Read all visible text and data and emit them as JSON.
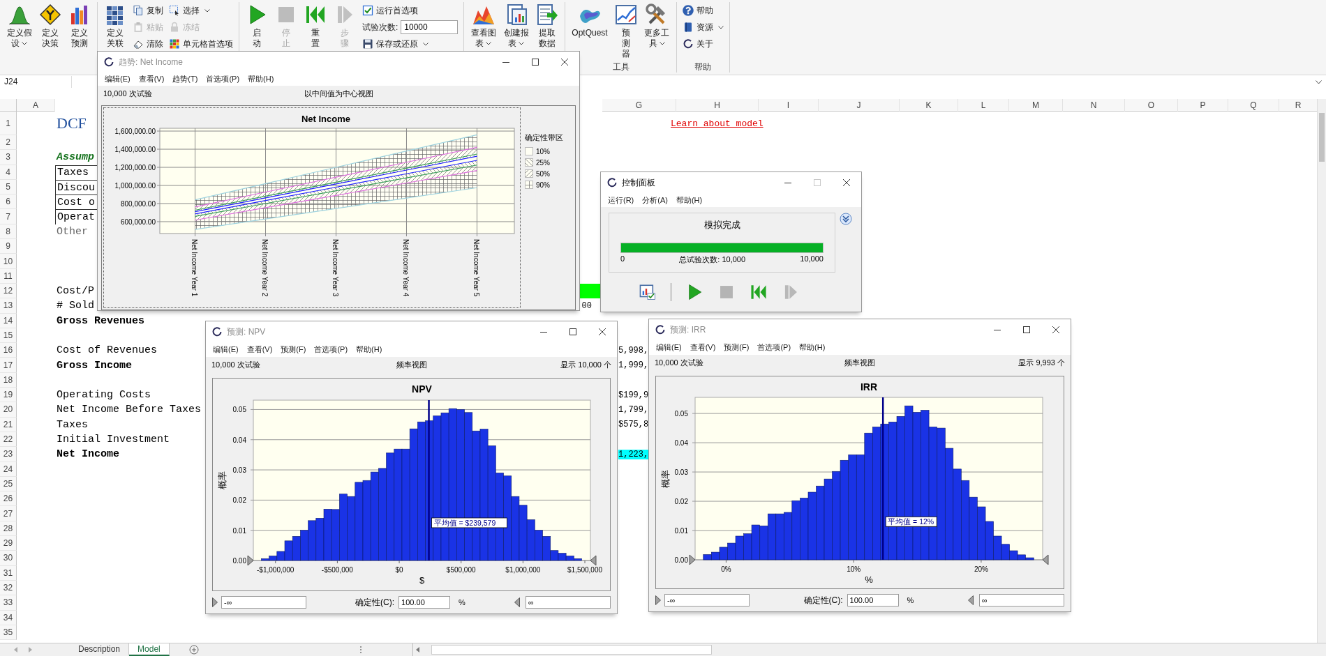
{
  "ribbon": {
    "groups": [
      {
        "items": [
          {
            "kind": "large",
            "label": "定义假设",
            "dropdown": true,
            "disabled": false
          },
          {
            "kind": "large",
            "label": "定义决策",
            "dropdown": false,
            "disabled": false
          },
          {
            "kind": "large",
            "label": "定义预测",
            "dropdown": false,
            "disabled": false
          }
        ]
      },
      {
        "items": [
          {
            "kind": "large",
            "label": "定义关联",
            "dropdown": false,
            "disabled": false
          },
          {
            "kind": "stack",
            "entries": [
              {
                "kind": "button",
                "label": "复制",
                "dropdown": false,
                "disabled": false
              },
              {
                "kind": "button",
                "label": "粘贴",
                "dropdown": false,
                "disabled": true
              },
              {
                "kind": "button",
                "label": "清除",
                "dropdown": false,
                "disabled": false
              }
            ]
          },
          {
            "kind": "stack",
            "entries": [
              {
                "kind": "button",
                "label": "选择",
                "dropdown": true,
                "disabled": false
              },
              {
                "kind": "button",
                "label": "冻结",
                "dropdown": false,
                "disabled": true
              },
              {
                "kind": "button",
                "label": "单元格首选项",
                "dropdown": false,
                "disabled": false
              }
            ]
          }
        ]
      },
      {
        "items": [
          {
            "kind": "large",
            "label": "启动",
            "dropdown": false,
            "disabled": false
          },
          {
            "kind": "large",
            "label": "停止",
            "dropdown": false,
            "disabled": true
          },
          {
            "kind": "large",
            "label": "重置",
            "dropdown": false,
            "disabled": false
          },
          {
            "kind": "large",
            "label": "步骤",
            "dropdown": false,
            "disabled": true
          },
          {
            "kind": "stack",
            "entries": [
              {
                "kind": "button",
                "label": "运行首选项",
                "dropdown": false,
                "disabled": false
              },
              {
                "kind": "field",
                "label": "试验次数:",
                "value": "10000"
              },
              {
                "kind": "button",
                "label": "保存或还原",
                "dropdown": true,
                "disabled": false
              }
            ]
          }
        ]
      },
      {
        "items": [
          {
            "kind": "large",
            "label": "查看图表",
            "dropdown": true,
            "disabled": false
          },
          {
            "kind": "large",
            "label": "创建报表",
            "dropdown": true,
            "disabled": false
          },
          {
            "kind": "large",
            "label": "提取数据",
            "dropdown": false,
            "disabled": false
          }
        ]
      },
      {
        "label": "工具",
        "items": [
          {
            "kind": "large",
            "label": "OptQuest",
            "dropdown": false,
            "disabled": false
          },
          {
            "kind": "large",
            "label": "预测器",
            "dropdown": false,
            "disabled": false
          },
          {
            "kind": "large",
            "label": "更多工具",
            "dropdown": true,
            "disabled": false
          }
        ]
      },
      {
        "label": "帮助",
        "items": [
          {
            "kind": "stack",
            "entries": [
              {
                "kind": "button",
                "label": "帮助",
                "dropdown": false,
                "disabled": false
              },
              {
                "kind": "button",
                "label": "资源",
                "dropdown": true,
                "disabled": false
              },
              {
                "kind": "button",
                "label": "关于",
                "dropdown": false,
                "disabled": false
              }
            ]
          }
        ]
      }
    ]
  },
  "name_box": "J24",
  "sheet": {
    "columns": [
      "A",
      "G",
      "H",
      "I",
      "J",
      "K",
      "L",
      "M",
      "N",
      "O",
      "P",
      "Q",
      "R"
    ],
    "rows": [
      {
        "number": "1",
        "kind": "title",
        "col_b": {
          "text": "DCF"
        },
        "col_h": {
          "text": "Learn about model",
          "kind": "link"
        }
      },
      {
        "number": "2"
      },
      {
        "number": "3",
        "kind": "section",
        "col_b": {
          "text": "Assump"
        }
      },
      {
        "number": "4",
        "kind": "boxed",
        "col_b": {
          "text": "Taxes"
        }
      },
      {
        "number": "5",
        "kind": "boxed",
        "col_b": {
          "text": "Discou"
        }
      },
      {
        "number": "6",
        "kind": "boxed",
        "col_b": {
          "text": "Cost o"
        }
      },
      {
        "number": "7",
        "kind": "boxed",
        "col_b": {
          "text": "Operat"
        }
      },
      {
        "number": "8",
        "kind": "muted",
        "col_b": {
          "text": "Other"
        }
      },
      {
        "number": "9"
      },
      {
        "number": "10"
      },
      {
        "number": "11"
      },
      {
        "number": "12",
        "kind": "plain",
        "col_b": {
          "text": "Cost/P"
        },
        "col_f": {
          "color": "#00ff00"
        }
      },
      {
        "number": "13",
        "kind": "plain",
        "col_b": {
          "text": "# Sold"
        },
        "col_f": {
          "text": "00"
        }
      },
      {
        "number": "14",
        "kind": "bold",
        "col_b": {
          "text": "Gross Revenues"
        }
      },
      {
        "number": "15"
      },
      {
        "number": "16",
        "kind": "plain",
        "col_b": {
          "text": "Cost of Revenues"
        },
        "col_g": {
          "text": "5,998,"
        }
      },
      {
        "number": "17",
        "kind": "bold",
        "col_b": {
          "text": "Gross Income"
        },
        "col_g": {
          "text": "1,999,"
        }
      },
      {
        "number": "18"
      },
      {
        "number": "19",
        "kind": "plain",
        "col_b": {
          "text": "Operating Costs"
        },
        "col_g": {
          "text": "$199,9"
        }
      },
      {
        "number": "20",
        "kind": "plain",
        "col_b": {
          "text": "Net Income Before Taxes"
        },
        "col_g": {
          "text": "1,799,"
        }
      },
      {
        "number": "21",
        "kind": "plain",
        "col_b": {
          "text": "Taxes"
        },
        "col_g": {
          "text": "$575,8"
        }
      },
      {
        "number": "22",
        "kind": "plain",
        "col_b": {
          "text": "Initial Investment"
        }
      },
      {
        "number": "23",
        "kind": "bold",
        "col_b": {
          "text": "Net Income"
        },
        "col_g": {
          "text": "1,223,",
          "color": "#00ffff"
        }
      },
      {
        "number": "24"
      },
      {
        "number": "25"
      },
      {
        "number": "26"
      },
      {
        "number": "27"
      },
      {
        "number": "28"
      },
      {
        "number": "29"
      },
      {
        "number": "30"
      },
      {
        "number": "31"
      },
      {
        "number": "32"
      },
      {
        "number": "33"
      },
      {
        "number": "34"
      },
      {
        "number": "35"
      }
    ]
  },
  "sheet_tabs": [
    {
      "label": "Description",
      "selected": false
    },
    {
      "label": "Model",
      "selected": true
    }
  ],
  "trend_window": {
    "title": "趋势: Net Income",
    "active": false,
    "maximize_enabled": true,
    "menu": [
      "编辑(E)",
      "查看(V)",
      "趋势(T)",
      "首选项(P)",
      "帮助(H)"
    ],
    "trials": "10,000 次试验",
    "view": "以中间值为中心视图",
    "legend_title": "确定性带区",
    "legend": [
      "10%",
      "25%",
      "50%",
      "90%"
    ],
    "chart_data": {
      "type": "line",
      "title": "Net Income",
      "grid": true,
      "categories": [
        "Net Income Year 1",
        "Net Income Year 2",
        "Net Income Year 3",
        "Net Income Year 4",
        "Net Income Year 5"
      ],
      "ylim": [
        469000,
        1631000
      ],
      "yticks": [
        {
          "value": 600000,
          "label": "600,000.00"
        },
        {
          "value": 800000,
          "label": "800,000.00"
        },
        {
          "value": 1000000,
          "label": "1,000,000.00"
        },
        {
          "value": 1200000,
          "label": "1,200,000.00"
        },
        {
          "value": 1400000,
          "label": "1,400,000.00"
        },
        {
          "value": 1600000,
          "label": "1,600,000.00"
        }
      ],
      "series": [
        {
          "color": "#2020ff",
          "values": [
            710000,
            863000,
            1016000,
            1169000,
            1322000
          ]
        },
        {
          "color": "#2020ff",
          "values": [
            686000,
            834000,
            981000,
            1129000,
            1277000
          ]
        },
        {
          "color": "#3aa05a",
          "values": [
            727000,
            882000,
            1036000,
            1191000,
            1346000
          ]
        },
        {
          "color": "#3aa05a",
          "values": [
            658000,
            800000,
            941000,
            1083000,
            1225000
          ]
        },
        {
          "color": "#e070e0",
          "values": [
            762000,
            927000,
            1091000,
            1256000,
            1421000
          ]
        },
        {
          "color": "#e070e0",
          "values": [
            617000,
            754000,
            890000,
            1027000,
            1164000
          ]
        },
        {
          "color": "#9fd4e0",
          "values": [
            841000,
            1020000,
            1200000,
            1380000,
            1559000
          ]
        },
        {
          "color": "#9fd4e0",
          "values": [
            514000,
            629000,
            745000,
            860000,
            975000
          ]
        }
      ]
    }
  },
  "control_panel": {
    "title": "控制面板",
    "active": true,
    "maximize_enabled": false,
    "menu": [
      "运行(R)",
      "分析(A)",
      "帮助(H)"
    ],
    "status": "模拟完成",
    "progress": {
      "level": 1,
      "start": "0",
      "label": "总试验次数: 10,000",
      "end": "10,000"
    },
    "toolbar": [
      {
        "disabled": false
      },
      {
        "disabled": false
      },
      {
        "disabled": true
      },
      {
        "disabled": false
      },
      {
        "disabled": true
      }
    ]
  },
  "forecast_windows": [
    {
      "title": "预测: NPV",
      "active": false,
      "maximize_enabled": true,
      "menu": [
        "编辑(E)",
        "查看(V)",
        "预测(F)",
        "首选项(P)",
        "帮助(H)"
      ],
      "trials": "10,000 次试验",
      "view": "频率视图",
      "shown": "显示 10,000 个",
      "chart_data": {
        "type": "bar",
        "title": "NPV",
        "xlabel": "$",
        "ylabel": "概率",
        "grid": true,
        "x": [
          -1083000,
          -1019850,
          -956700,
          -893550,
          -830400,
          -767250,
          -704100,
          -640950,
          -577800,
          -514650,
          -451500,
          -388350,
          -325200,
          -262050,
          -198900,
          -135750,
          -72600,
          -9450,
          53700,
          116850,
          180000,
          243150,
          306300,
          369450,
          432600,
          495750,
          558900,
          622050,
          685200,
          748350,
          811500,
          874650,
          937800,
          1000950,
          1064100,
          1127250,
          1190400,
          1253550,
          1316700,
          1379850,
          1443000
        ],
        "series": [
          {
            "color": "#1a33e6",
            "values": [
              0.0006,
              0.0015,
              0.003,
              0.0065,
              0.008,
              0.01,
              0.0132,
              0.014,
              0.017,
              0.0169,
              0.022,
              0.0212,
              0.0259,
              0.0265,
              0.0293,
              0.0305,
              0.0356,
              0.0369,
              0.0369,
              0.0436,
              0.0459,
              0.0463,
              0.0479,
              0.0489,
              0.0503,
              0.05,
              0.049,
              0.0429,
              0.0435,
              0.038,
              0.029,
              0.028,
              0.0212,
              0.0183,
              0.0135,
              0.01,
              0.008,
              0.0033,
              0.0024,
              0.0015,
              0.0006
            ]
          }
        ],
        "xlim": [
          -1179000,
          1545000
        ],
        "ylim": [
          0,
          0.0531
        ],
        "xticks": [
          {
            "value": -1000000,
            "label": "-$1,000,000"
          },
          {
            "value": -500000,
            "label": "-$500,000"
          },
          {
            "value": 0,
            "label": "$0"
          },
          {
            "value": 500000,
            "label": "$500,000"
          },
          {
            "value": 1000000,
            "label": "$1,000,000"
          },
          {
            "value": 1500000,
            "label": "$1,500,000"
          }
        ],
        "yticks": [
          {
            "value": 0,
            "label": "0.00"
          },
          {
            "value": 0.01,
            "label": "0.01"
          },
          {
            "value": 0.02,
            "label": "0.02"
          },
          {
            "value": 0.03,
            "label": "0.03"
          },
          {
            "value": 0.04,
            "label": "0.04"
          },
          {
            "value": 0.05,
            "label": "0.05"
          }
        ],
        "ref_lines": [
          {
            "axis": "x",
            "value": 239579
          }
        ],
        "annotations": [
          {
            "text": "平均值 = $239,579"
          }
        ]
      },
      "lower": "-∞",
      "certainty_label": "确定性(C):",
      "certainty": "100.00",
      "unit": "%",
      "upper": "∞"
    },
    {
      "title": "预测: IRR",
      "active": false,
      "maximize_enabled": true,
      "menu": [
        "编辑(E)",
        "查看(V)",
        "预测(F)",
        "首选项(P)",
        "帮助(H)"
      ],
      "trials": "10,000 次试验",
      "view": "频率视图",
      "shown": "显示 9,993 个",
      "chart_data": {
        "type": "bar",
        "title": "IRR",
        "xlabel": "%",
        "ylabel": "概率",
        "grid": true,
        "x": [
          -1.47,
          -0.84,
          -0.2,
          0.43,
          1.06,
          1.69,
          2.32,
          2.96,
          3.59,
          4.22,
          4.85,
          5.48,
          6.12,
          6.75,
          7.38,
          8.01,
          8.64,
          9.27,
          9.91,
          10.54,
          11.17,
          11.8,
          12.43,
          13.07,
          13.7,
          14.33,
          14.96,
          15.59,
          16.22,
          16.86,
          17.49,
          18.12,
          18.75,
          19.38,
          20.02,
          20.65,
          21.28,
          21.91,
          22.54,
          23.17,
          23.81
        ],
        "series": [
          {
            "color": "#1a33e6",
            "values": [
              0.0018,
              0.0026,
              0.0043,
              0.0057,
              0.0081,
              0.0089,
              0.0119,
              0.0116,
              0.0157,
              0.0157,
              0.0162,
              0.0202,
              0.0211,
              0.0231,
              0.0252,
              0.0276,
              0.0302,
              0.034,
              0.0359,
              0.0359,
              0.0433,
              0.0454,
              0.0464,
              0.0471,
              0.049,
              0.0526,
              0.0504,
              0.0511,
              0.0454,
              0.045,
              0.0381,
              0.031,
              0.0271,
              0.0214,
              0.0181,
              0.0131,
              0.0081,
              0.0053,
              0.0031,
              0.0017,
              0.0007
            ]
          }
        ],
        "xlim": [
          -2.43,
          24.82
        ],
        "ylim": [
          0,
          0.0555
        ],
        "xticks": [
          {
            "value": 0,
            "label": "0%"
          },
          {
            "value": 10,
            "label": "10%"
          },
          {
            "value": 20,
            "label": "20%"
          }
        ],
        "yticks": [
          {
            "value": 0,
            "label": "0.00"
          },
          {
            "value": 0.01,
            "label": "0.01"
          },
          {
            "value": 0.02,
            "label": "0.02"
          },
          {
            "value": 0.03,
            "label": "0.03"
          },
          {
            "value": 0.04,
            "label": "0.04"
          },
          {
            "value": 0.05,
            "label": "0.05"
          }
        ],
        "ref_lines": [
          {
            "axis": "x",
            "value": 12.3
          }
        ],
        "annotations": [
          {
            "text": "平均值 = 12%"
          }
        ]
      },
      "lower": "-∞",
      "certainty_label": "确定性(C):",
      "certainty": "100.00",
      "unit": "%",
      "upper": "∞"
    }
  ]
}
